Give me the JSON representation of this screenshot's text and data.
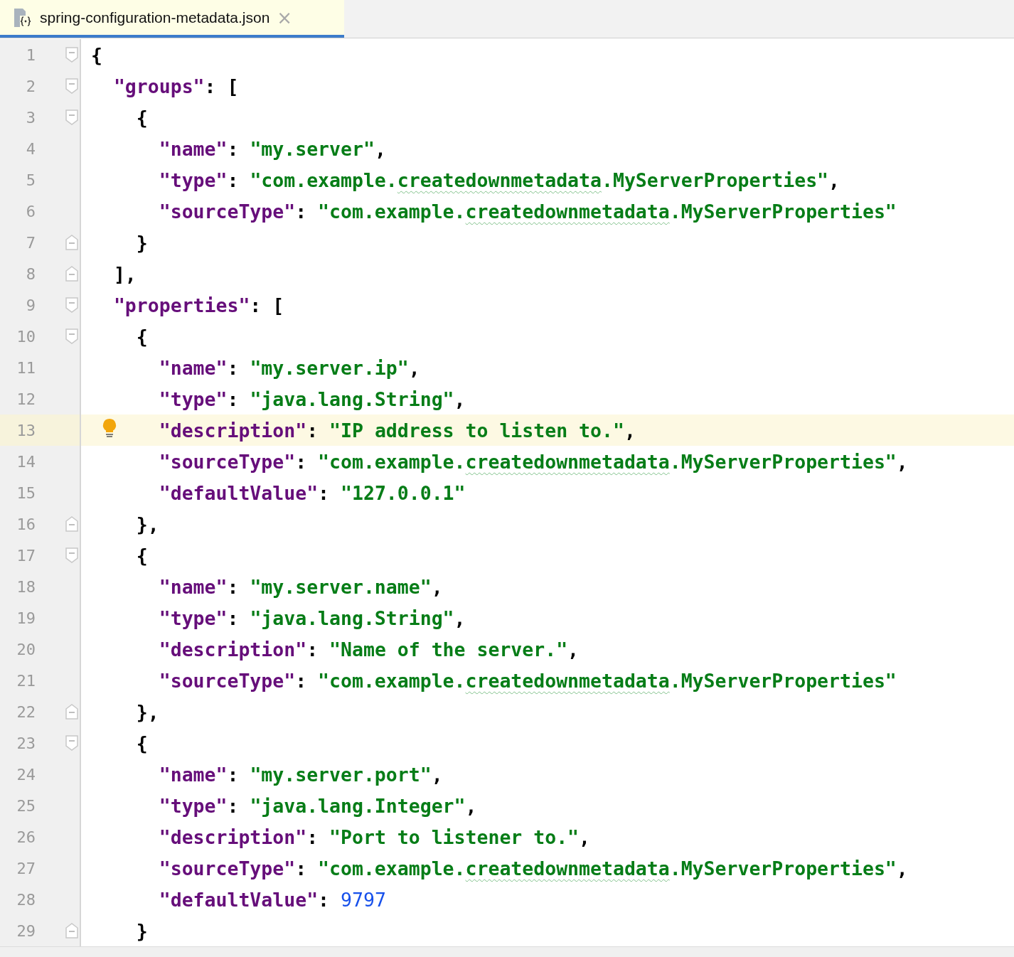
{
  "tab": {
    "title": "spring-configuration-metadata.json",
    "close": "×",
    "selected": true
  },
  "lines": [
    {
      "number": "1",
      "fold_start": true,
      "fold_end": false,
      "current": false,
      "bulb": false,
      "tokens": [
        {
          "kind": "punct",
          "text": "{"
        }
      ]
    },
    {
      "number": "2",
      "fold_start": true,
      "fold_end": false,
      "current": false,
      "bulb": false,
      "tokens": [
        {
          "kind": "key",
          "text": "\"groups\""
        },
        {
          "kind": "punct",
          "text": ": ["
        }
      ]
    },
    {
      "number": "3",
      "fold_start": true,
      "fold_end": false,
      "current": false,
      "bulb": false,
      "tokens": [
        {
          "kind": "punct",
          "text": "{"
        }
      ]
    },
    {
      "number": "4",
      "fold_start": false,
      "fold_end": false,
      "current": false,
      "bulb": false,
      "tokens": [
        {
          "kind": "key",
          "text": "\"name\""
        },
        {
          "kind": "punct",
          "text": ": "
        },
        {
          "kind": "string",
          "text": "\"my.server\""
        },
        {
          "kind": "punct",
          "text": ","
        }
      ]
    },
    {
      "number": "5",
      "fold_start": false,
      "fold_end": false,
      "current": false,
      "bulb": false,
      "tokens": [
        {
          "kind": "key",
          "text": "\"type\""
        },
        {
          "kind": "punct",
          "text": ": "
        },
        {
          "kind": "string",
          "text": "\"com.example."
        },
        {
          "kind": "typo",
          "text": "createdownmetadata"
        },
        {
          "kind": "string",
          "text": ".MyServerProperties\""
        },
        {
          "kind": "punct",
          "text": ","
        }
      ]
    },
    {
      "number": "6",
      "fold_start": false,
      "fold_end": false,
      "current": false,
      "bulb": false,
      "tokens": [
        {
          "kind": "key",
          "text": "\"sourceType\""
        },
        {
          "kind": "punct",
          "text": ": "
        },
        {
          "kind": "string",
          "text": "\"com.example."
        },
        {
          "kind": "typo",
          "text": "createdownmetadata"
        },
        {
          "kind": "string",
          "text": ".MyServerProperties\""
        }
      ]
    },
    {
      "number": "7",
      "fold_start": false,
      "fold_end": true,
      "current": false,
      "bulb": false,
      "tokens": [
        {
          "kind": "punct",
          "text": "}"
        }
      ]
    },
    {
      "number": "8",
      "fold_start": false,
      "fold_end": true,
      "current": false,
      "bulb": false,
      "tokens": [
        {
          "kind": "punct",
          "text": "],"
        }
      ]
    },
    {
      "number": "9",
      "fold_start": true,
      "fold_end": false,
      "current": false,
      "bulb": false,
      "tokens": [
        {
          "kind": "key",
          "text": "\"properties\""
        },
        {
          "kind": "punct",
          "text": ": ["
        }
      ]
    },
    {
      "number": "10",
      "fold_start": true,
      "fold_end": false,
      "current": false,
      "bulb": false,
      "tokens": [
        {
          "kind": "punct",
          "text": "{"
        }
      ]
    },
    {
      "number": "11",
      "fold_start": false,
      "fold_end": false,
      "current": false,
      "bulb": false,
      "tokens": [
        {
          "kind": "key",
          "text": "\"name\""
        },
        {
          "kind": "punct",
          "text": ": "
        },
        {
          "kind": "string",
          "text": "\"my.server.ip\""
        },
        {
          "kind": "punct",
          "text": ","
        }
      ]
    },
    {
      "number": "12",
      "fold_start": false,
      "fold_end": false,
      "current": false,
      "bulb": false,
      "tokens": [
        {
          "kind": "key",
          "text": "\"type\""
        },
        {
          "kind": "punct",
          "text": ": "
        },
        {
          "kind": "string",
          "text": "\"java.lang.String\""
        },
        {
          "kind": "punct",
          "text": ","
        }
      ]
    },
    {
      "number": "13",
      "fold_start": false,
      "fold_end": false,
      "current": true,
      "bulb": true,
      "tokens": [
        {
          "kind": "key",
          "text": "\"description\""
        },
        {
          "kind": "punct",
          "text": ": "
        },
        {
          "kind": "string",
          "text": "\"IP address to listen to.\""
        },
        {
          "kind": "punct",
          "text": ","
        }
      ]
    },
    {
      "number": "14",
      "fold_start": false,
      "fold_end": false,
      "current": false,
      "bulb": false,
      "tokens": [
        {
          "kind": "key",
          "text": "\"sourceType\""
        },
        {
          "kind": "punct",
          "text": ": "
        },
        {
          "kind": "string",
          "text": "\"com.example."
        },
        {
          "kind": "typo",
          "text": "createdownmetadata"
        },
        {
          "kind": "string",
          "text": ".MyServerProperties\""
        },
        {
          "kind": "punct",
          "text": ","
        }
      ]
    },
    {
      "number": "15",
      "fold_start": false,
      "fold_end": false,
      "current": false,
      "bulb": false,
      "tokens": [
        {
          "kind": "key",
          "text": "\"defaultValue\""
        },
        {
          "kind": "punct",
          "text": ": "
        },
        {
          "kind": "string",
          "text": "\"127.0.0.1\""
        }
      ]
    },
    {
      "number": "16",
      "fold_start": false,
      "fold_end": true,
      "current": false,
      "bulb": false,
      "tokens": [
        {
          "kind": "punct",
          "text": "},"
        }
      ]
    },
    {
      "number": "17",
      "fold_start": true,
      "fold_end": false,
      "current": false,
      "bulb": false,
      "tokens": [
        {
          "kind": "punct",
          "text": "{"
        }
      ]
    },
    {
      "number": "18",
      "fold_start": false,
      "fold_end": false,
      "current": false,
      "bulb": false,
      "tokens": [
        {
          "kind": "key",
          "text": "\"name\""
        },
        {
          "kind": "punct",
          "text": ": "
        },
        {
          "kind": "string",
          "text": "\"my.server.name\""
        },
        {
          "kind": "punct",
          "text": ","
        }
      ]
    },
    {
      "number": "19",
      "fold_start": false,
      "fold_end": false,
      "current": false,
      "bulb": false,
      "tokens": [
        {
          "kind": "key",
          "text": "\"type\""
        },
        {
          "kind": "punct",
          "text": ": "
        },
        {
          "kind": "string",
          "text": "\"java.lang.String\""
        },
        {
          "kind": "punct",
          "text": ","
        }
      ]
    },
    {
      "number": "20",
      "fold_start": false,
      "fold_end": false,
      "current": false,
      "bulb": false,
      "tokens": [
        {
          "kind": "key",
          "text": "\"description\""
        },
        {
          "kind": "punct",
          "text": ": "
        },
        {
          "kind": "string",
          "text": "\"Name of the server.\""
        },
        {
          "kind": "punct",
          "text": ","
        }
      ]
    },
    {
      "number": "21",
      "fold_start": false,
      "fold_end": false,
      "current": false,
      "bulb": false,
      "tokens": [
        {
          "kind": "key",
          "text": "\"sourceType\""
        },
        {
          "kind": "punct",
          "text": ": "
        },
        {
          "kind": "string",
          "text": "\"com.example."
        },
        {
          "kind": "typo",
          "text": "createdownmetadata"
        },
        {
          "kind": "string",
          "text": ".MyServerProperties\""
        }
      ]
    },
    {
      "number": "22",
      "fold_start": false,
      "fold_end": true,
      "current": false,
      "bulb": false,
      "tokens": [
        {
          "kind": "punct",
          "text": "},"
        }
      ]
    },
    {
      "number": "23",
      "fold_start": true,
      "fold_end": false,
      "current": false,
      "bulb": false,
      "tokens": [
        {
          "kind": "punct",
          "text": "{"
        }
      ]
    },
    {
      "number": "24",
      "fold_start": false,
      "fold_end": false,
      "current": false,
      "bulb": false,
      "tokens": [
        {
          "kind": "key",
          "text": "\"name\""
        },
        {
          "kind": "punct",
          "text": ": "
        },
        {
          "kind": "string",
          "text": "\"my.server.port\""
        },
        {
          "kind": "punct",
          "text": ","
        }
      ]
    },
    {
      "number": "25",
      "fold_start": false,
      "fold_end": false,
      "current": false,
      "bulb": false,
      "tokens": [
        {
          "kind": "key",
          "text": "\"type\""
        },
        {
          "kind": "punct",
          "text": ": "
        },
        {
          "kind": "string",
          "text": "\"java.lang.Integer\""
        },
        {
          "kind": "punct",
          "text": ","
        }
      ]
    },
    {
      "number": "26",
      "fold_start": false,
      "fold_end": false,
      "current": false,
      "bulb": false,
      "tokens": [
        {
          "kind": "key",
          "text": "\"description\""
        },
        {
          "kind": "punct",
          "text": ": "
        },
        {
          "kind": "string",
          "text": "\"Port to listener to.\""
        },
        {
          "kind": "punct",
          "text": ","
        }
      ]
    },
    {
      "number": "27",
      "fold_start": false,
      "fold_end": false,
      "current": false,
      "bulb": false,
      "tokens": [
        {
          "kind": "key",
          "text": "\"sourceType\""
        },
        {
          "kind": "punct",
          "text": ": "
        },
        {
          "kind": "string",
          "text": "\"com.example."
        },
        {
          "kind": "typo",
          "text": "createdownmetadata"
        },
        {
          "kind": "string",
          "text": ".MyServerProperties\""
        },
        {
          "kind": "punct",
          "text": ","
        }
      ]
    },
    {
      "number": "28",
      "fold_start": false,
      "fold_end": false,
      "current": false,
      "bulb": false,
      "tokens": [
        {
          "kind": "key",
          "text": "\"defaultValue\""
        },
        {
          "kind": "punct",
          "text": ": "
        },
        {
          "kind": "number",
          "text": "9797"
        }
      ]
    },
    {
      "number": "29",
      "fold_start": false,
      "fold_end": true,
      "current": false,
      "bulb": false,
      "tokens": [
        {
          "kind": "punct",
          "text": "}"
        }
      ]
    }
  ]
}
